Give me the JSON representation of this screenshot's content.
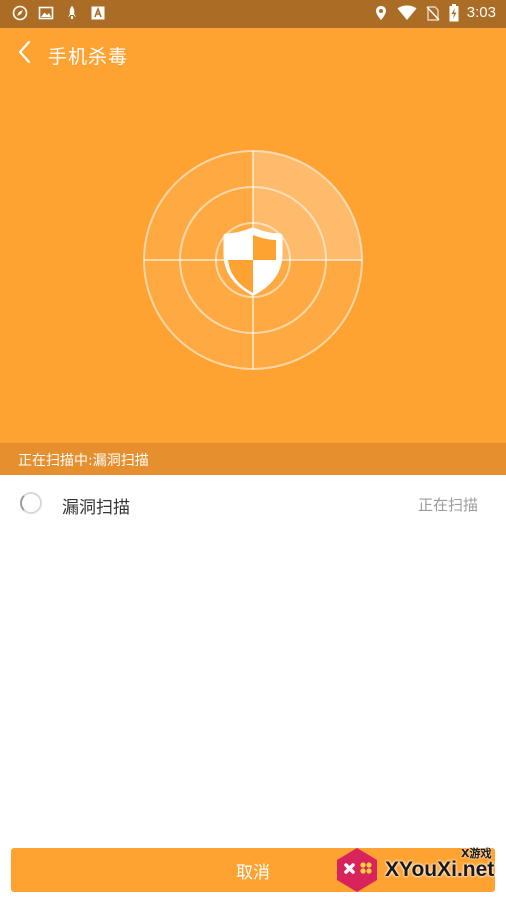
{
  "status_bar": {
    "time": "3:03",
    "left_icons": [
      "compass-icon",
      "image-icon",
      "rocket-icon",
      "font-icon"
    ],
    "right_icons": [
      "location-icon",
      "wifi-icon",
      "no-sim-icon",
      "battery-charging-icon"
    ]
  },
  "header": {
    "back_icon": "chevron-left-icon",
    "title": "手机杀毒"
  },
  "radar": {
    "center_icon": "shield-icon"
  },
  "scan_strip": {
    "text": "正在扫描中:漏洞扫描"
  },
  "scan_items": [
    {
      "label": "漏洞扫描",
      "status": "正在扫描"
    }
  ],
  "cancel_label": "取消",
  "watermark": {
    "site": "XYouXi.net",
    "tag": "X游戏"
  },
  "colors": {
    "accent": "#fea232",
    "status_bar": "#ab6d25",
    "strip": "#e58f2e"
  }
}
